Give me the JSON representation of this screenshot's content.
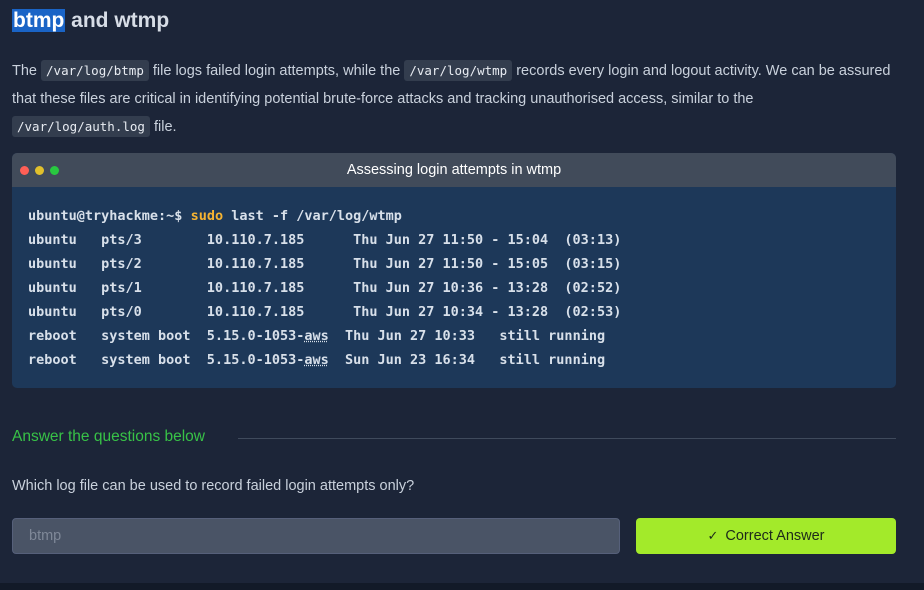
{
  "heading": {
    "highlight": "btmp",
    "rest": " and wtmp"
  },
  "paragraph": {
    "t1": "The ",
    "code1": "/var/log/btmp",
    "t2": " file logs failed login attempts, while the ",
    "code2": "/var/log/wtmp",
    "t3": " records every login and logout activity. We can be assured that these files are critical in identifying potential brute-force attacks and tracking unauthorised access, similar to the ",
    "code3": "/var/log/auth.log",
    "t4": " file."
  },
  "terminal": {
    "title": "Assessing login attempts in wtmp",
    "prompt": "ubuntu@tryhackme:~$ ",
    "sudo": "sudo",
    "command": " last -f /var/log/wtmp",
    "lines": [
      "ubuntu   pts/3        10.110.7.185      Thu Jun 27 11:50 - 15:04  (03:13)",
      "ubuntu   pts/2        10.110.7.185      Thu Jun 27 11:50 - 15:05  (03:15)",
      "ubuntu   pts/1        10.110.7.185      Thu Jun 27 10:36 - 13:28  (02:52)",
      "ubuntu   pts/0        10.110.7.185      Thu Jun 27 10:34 - 13:28  (02:53)"
    ],
    "reboot_lines": [
      {
        "pre": "reboot   system boot  5.15.0-1053-",
        "aws": "aws",
        "post": "  Thu Jun 27 10:33   still running"
      },
      {
        "pre": "reboot   system boot  5.15.0-1053-",
        "aws": "aws",
        "post": "  Sun Jun 23 16:34   still running"
      }
    ]
  },
  "answers": {
    "heading": "Answer the questions below",
    "question": "Which log file can be used to record failed login attempts only?",
    "input_value": "btmp",
    "button_label": "Correct Answer",
    "button_icon": "check-icon"
  },
  "colors": {
    "accent_green": "#38c247",
    "button_green": "#a3ea2a",
    "terminal_bg": "#1d3859",
    "highlight_blue": "#1a64c6"
  }
}
